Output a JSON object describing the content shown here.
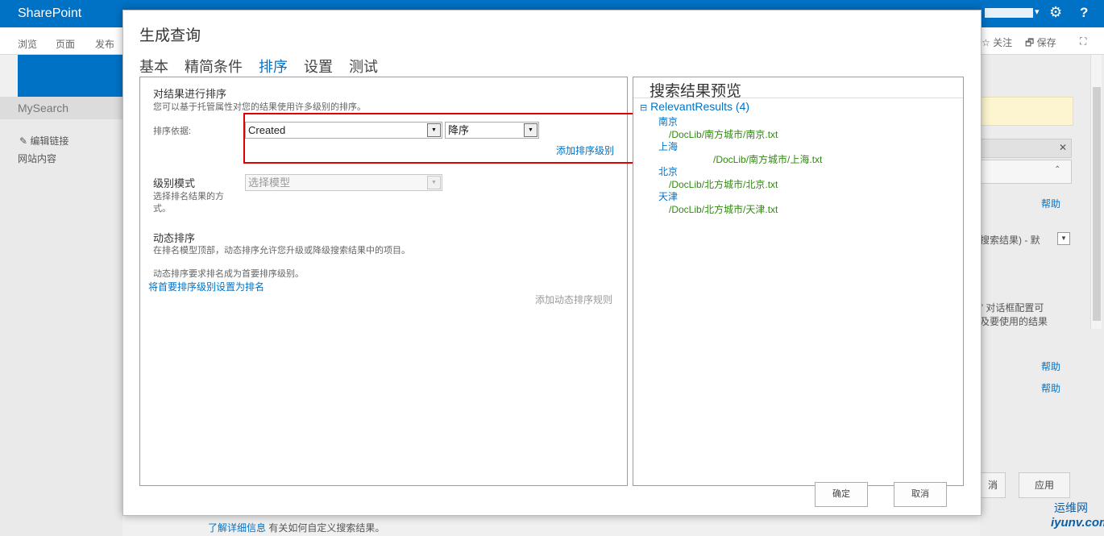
{
  "suite": {
    "brand": "SharePoint",
    "help": "?"
  },
  "ribbon": {
    "tabs": [
      "浏览",
      "页面",
      "发布"
    ],
    "follow": "关注",
    "save": "保存"
  },
  "leftnav": {
    "site": "MySearch",
    "edit_links": "编辑链接",
    "site_contents": "网站内容"
  },
  "rightpane": {
    "help1": "帮助",
    "dropdown_fragment": "搜索结果) - 默",
    "note_line1": "” 对话框配置可",
    "note_line2": "及要使用的结果",
    "help2": "帮助",
    "help3": "帮助",
    "btn_cancel_fragment": "消",
    "btn_apply": "应用"
  },
  "bottom": {
    "link": "了解详细信息",
    "text": " 有关如何自定义搜索结果。"
  },
  "watermark": {
    "top": "运维网",
    "bottom": "iyunv.com"
  },
  "dialog": {
    "title": "生成查询",
    "tabs": [
      "基本",
      "精简条件",
      "排序",
      "设置",
      "测试"
    ],
    "selected_tab": "排序",
    "sorting": {
      "heading": "对结果进行排序",
      "desc": "您可以基于托管属性对您的结果使用许多级别的排序。",
      "sort_by_label": "排序依据:",
      "sort_field": "Created",
      "sort_order": "降序",
      "add_level": "添加排序级别"
    },
    "ranking": {
      "heading": "级别模式",
      "desc_line1": "选择排名结果的方",
      "desc_line2": "式。",
      "select_placeholder": "选择模型"
    },
    "dynamic": {
      "heading": "动态排序",
      "desc1": "在排名模型顶部，动态排序允许您升级或降级搜索结果中的项目。",
      "desc2": "动态排序要求排名成为首要排序级别。",
      "set_rank_link": "将首要排序级别设置为排名",
      "add_rule": "添加动态排序规则"
    },
    "preview": {
      "title": "搜索结果预览",
      "group": "RelevantResults (4)",
      "results": [
        {
          "title": "南京",
          "url": "/DocLib/南方城市/南京.txt"
        },
        {
          "title": "上海",
          "url": "/DocLib/南方城市/上海.txt"
        },
        {
          "title": "北京",
          "url": "/DocLib/北方城市/北京.txt"
        },
        {
          "title": "天津",
          "url": "/DocLib/北方城市/天津.txt"
        }
      ]
    },
    "ok": "确定",
    "cancel": "取消"
  },
  "colors": {
    "accent": "#0072c6",
    "highlight": "#e00000",
    "url_green": "#2f8a0e"
  }
}
